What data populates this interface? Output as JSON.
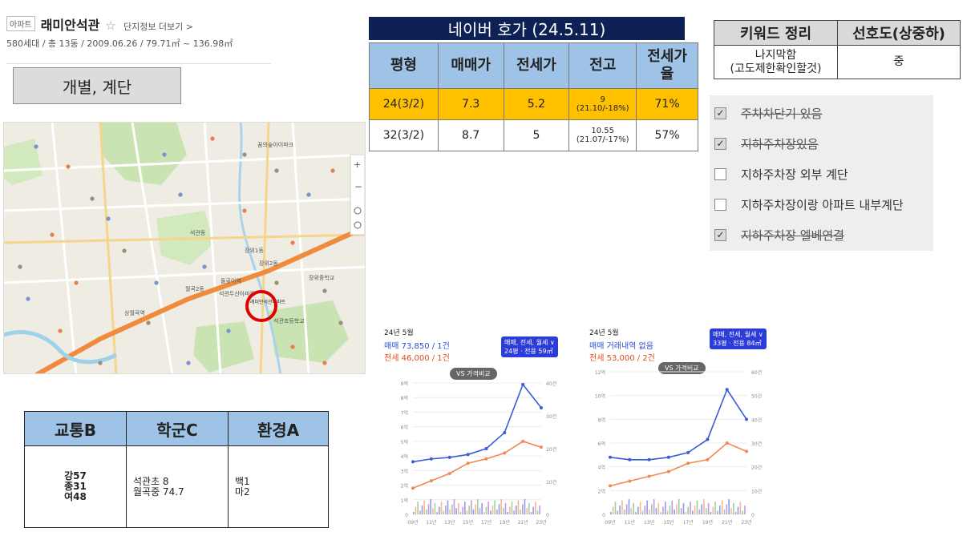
{
  "complex": {
    "type_badge": "아파트",
    "name": "래미안석관",
    "star": "☆",
    "detail_link": "단지정보 더보기 >",
    "meta": "580세대 / 총 13동 / 2009.06.26 / 79.71㎡ ~ 136.98㎡"
  },
  "note_label": "개별, 계단",
  "naver": {
    "title": "네이버 호가 (24.5.11)",
    "headers": [
      "평형",
      "매매가",
      "전세가",
      "전고",
      "전세가율"
    ],
    "rows": [
      {
        "type": "24(3/2)",
        "sale": "7.3",
        "jeonse": "5.2",
        "high_line1": "9",
        "high_line2": "(21.10/-18%)",
        "rate": "71%",
        "highlight": true
      },
      {
        "type": "32(3/2)",
        "sale": "8.7",
        "jeonse": "5",
        "high_line1": "10.55",
        "high_line2": "(21.07/-17%)",
        "rate": "57%",
        "highlight": false
      }
    ]
  },
  "keywords": {
    "headers": [
      "키워드 정리",
      "선호도(상중하)"
    ],
    "keyword_line1": "나지막함",
    "keyword_line2": "(고도제한확인할것)",
    "preference": "중"
  },
  "checklist": [
    {
      "label": "주차차단기 있음",
      "checked": true
    },
    {
      "label": "지하주차장있음",
      "checked": true
    },
    {
      "label": "지하주차장 외부 계단",
      "checked": false
    },
    {
      "label": "지하주차장이랑 아파트 내부계단",
      "checked": false
    },
    {
      "label": "지하주차장 엘베연결",
      "checked": true
    }
  ],
  "grades": {
    "headers": [
      "교통B",
      "학군C",
      "환경A"
    ],
    "transport": [
      "강57",
      "종31",
      "여48"
    ],
    "school": [
      "석관초 8",
      "월곡중 74.7"
    ],
    "environment": [
      "백1",
      "마2"
    ]
  },
  "map": {
    "target_label": "래미안석관아파트",
    "labels": [
      "석관동",
      "장위1동",
      "장위2동",
      "월곡2동",
      "석관초등학교",
      "장위중학교",
      "돌곶이역",
      "상월곡역",
      "석관두산아파트",
      "꿈의숲아이파크"
    ],
    "colors": {
      "road_major": "#f08a3c",
      "park": "#c9e3b2",
      "water": "#a9d3ec",
      "target_circle": "#e00000"
    }
  },
  "charts": [
    {
      "month": "24년 5월",
      "sale_text": "매매 73,850 / 1건",
      "rent_text": "전세 46,000 / 1건",
      "pill_line1": "매매, 전세, 월세 ∨",
      "pill_line2": "24평 · 전용 59㎡",
      "vs_label": "VS 가격비교",
      "colors": {
        "sale": "#3a5bd9",
        "rent": "#f08a55"
      }
    },
    {
      "month": "24년 5월",
      "sale_text": "매매 거래내역 없음",
      "rent_text": "전세 53,000 / 2건",
      "pill_line1": "매매, 전세, 월세 ∨",
      "pill_line2": "33평 · 전용 84㎡",
      "vs_label": "VS 가격비교",
      "colors": {
        "sale": "#3a5bd9",
        "rent": "#f08a55"
      }
    }
  ],
  "chart_data": [
    {
      "type": "line",
      "title": "",
      "x": [
        "09년",
        "11년",
        "13년",
        "15년",
        "17년",
        "19년",
        "21년",
        "23년"
      ],
      "series": [
        {
          "name": "매매",
          "values": [
            3.6,
            3.8,
            3.9,
            4.1,
            4.5,
            5.6,
            8.9,
            7.3
          ]
        },
        {
          "name": "전세",
          "values": [
            1.8,
            2.3,
            2.8,
            3.5,
            3.8,
            4.2,
            5.0,
            4.6
          ]
        }
      ],
      "ylabel_left": [
        "0",
        "1억",
        "2억",
        "3억",
        "4억",
        "5억",
        "6억",
        "7억",
        "8억",
        "9억"
      ],
      "ylabel_right": [
        "0",
        "10건",
        "20건",
        "30건",
        "40건"
      ],
      "ylim": [
        0,
        9
      ]
    },
    {
      "type": "line",
      "title": "",
      "x": [
        "09년",
        "11년",
        "13년",
        "15년",
        "17년",
        "19년",
        "21년",
        "23년"
      ],
      "series": [
        {
          "name": "매매",
          "values": [
            4.8,
            4.6,
            4.6,
            4.8,
            5.2,
            6.3,
            10.5,
            8.0
          ]
        },
        {
          "name": "전세",
          "values": [
            2.4,
            2.8,
            3.2,
            3.6,
            4.3,
            4.6,
            6.0,
            5.3
          ]
        }
      ],
      "ylabel_left": [
        "0",
        "2억",
        "4억",
        "6억",
        "8억",
        "10억",
        "12억"
      ],
      "ylabel_right": [
        "0",
        "10건",
        "20건",
        "30건",
        "40건",
        "50건",
        "60건"
      ],
      "ylim": [
        0,
        12
      ]
    }
  ]
}
